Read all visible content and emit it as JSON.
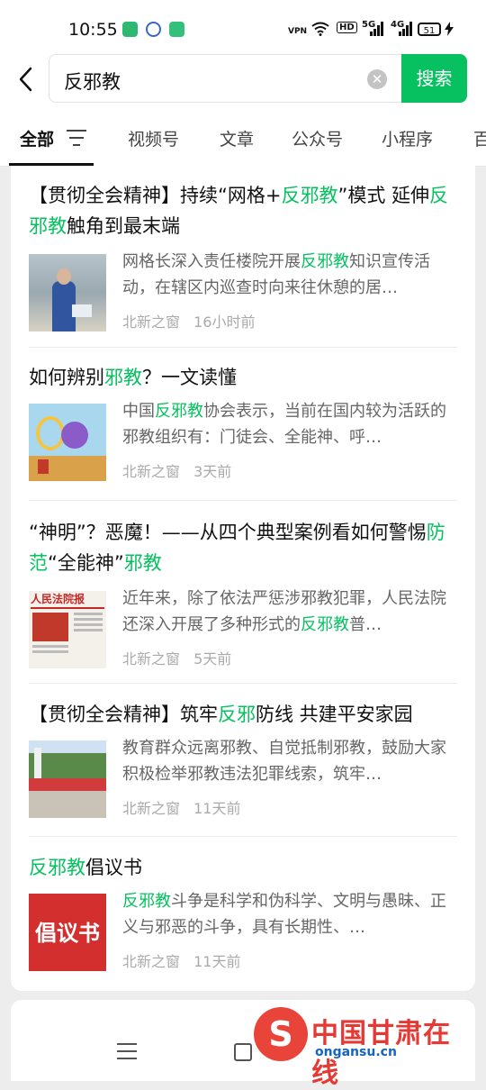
{
  "status_bar": {
    "time": "10:55",
    "vpn": "VPN",
    "hd": "HD",
    "net1": "5G",
    "net2": "4G",
    "battery": "51"
  },
  "search": {
    "query": "反邪教",
    "button_label": "搜索"
  },
  "tabs": [
    {
      "label": "全部"
    },
    {
      "label": "视频号"
    },
    {
      "label": "文章"
    },
    {
      "label": "公众号"
    },
    {
      "label": "小程序"
    },
    {
      "label": "百"
    }
  ],
  "articles": [
    {
      "title": [
        {
          "t": "【贯彻全会精神】持续“网格+",
          "h": false
        },
        {
          "t": "反邪教",
          "h": true
        },
        {
          "t": "”模式 延伸",
          "h": false
        },
        {
          "t": "反邪教",
          "h": true
        },
        {
          "t": "触角到最末端",
          "h": false
        }
      ],
      "summary": [
        {
          "t": "网格长深入责任楼院开展",
          "h": false
        },
        {
          "t": "反邪教",
          "h": true
        },
        {
          "t": "知识宣传活动，在辖区内巡查时向来往休憩的居…",
          "h": false
        }
      ],
      "source": "北新之窗",
      "time": "16小时前"
    },
    {
      "title": [
        {
          "t": "如何辨别",
          "h": false
        },
        {
          "t": "邪教",
          "h": true
        },
        {
          "t": "？一文读懂",
          "h": false
        }
      ],
      "summary": [
        {
          "t": "中国",
          "h": false
        },
        {
          "t": "反邪教",
          "h": true
        },
        {
          "t": "协会表示，当前在国内较为活跃的邪教组织有：门徒会、全能神、呼…",
          "h": false
        }
      ],
      "source": "北新之窗",
      "time": "3天前"
    },
    {
      "title": [
        {
          "t": "“神明”？恶魔！——从四个典型案例看如何警惕",
          "h": false
        },
        {
          "t": "防范",
          "h": true
        },
        {
          "t": "“全能神”",
          "h": false
        },
        {
          "t": "邪教",
          "h": true
        }
      ],
      "summary": [
        {
          "t": "近年来，除了依法严惩涉邪教犯罪，人民法院还深入开展了多种形式的",
          "h": false
        },
        {
          "t": "反邪教",
          "h": true
        },
        {
          "t": "普…",
          "h": false
        }
      ],
      "source": "北新之窗",
      "time": "5天前",
      "thumb_text": "人民法院报"
    },
    {
      "title": [
        {
          "t": "【贯彻全会精神】筑牢",
          "h": false
        },
        {
          "t": "反邪",
          "h": true
        },
        {
          "t": "防线 共建平安家园",
          "h": false
        }
      ],
      "summary": [
        {
          "t": "教育群众远离邪教、自觉抵制邪教，鼓励大家积极检举邪教违法犯罪线索，筑牢…",
          "h": false
        }
      ],
      "source": "北新之窗",
      "time": "11天前"
    },
    {
      "title": [
        {
          "t": "反邪教",
          "h": true
        },
        {
          "t": "倡议书",
          "h": false
        }
      ],
      "summary": [
        {
          "t": "反邪教",
          "h": true
        },
        {
          "t": "斗争是科学和伪科学、文明与愚昧、正义与邪恶的斗争，具有长期性、…",
          "h": false
        }
      ],
      "source": "北新之窗",
      "time": "11天前",
      "thumb_text": "倡议书"
    }
  ],
  "watermark": {
    "title": "中国甘肃在线",
    "url": "ongansu.cn"
  },
  "colors": {
    "accent": "#07c160",
    "watermark_red": "#e53935"
  }
}
